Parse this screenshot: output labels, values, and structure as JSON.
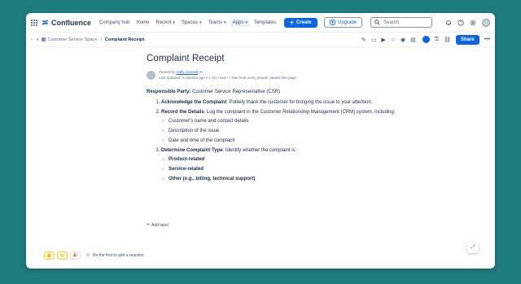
{
  "topnav": {
    "app_name": "Confluence",
    "items": [
      {
        "label": "Company hub",
        "has_chevron": false
      },
      {
        "label": "Home",
        "has_chevron": false
      },
      {
        "label": "Recent",
        "has_chevron": true
      },
      {
        "label": "Spaces",
        "has_chevron": true
      },
      {
        "label": "Teams",
        "has_chevron": true
      },
      {
        "label": "Apps",
        "has_chevron": true
      },
      {
        "label": "Templates",
        "has_chevron": false
      }
    ],
    "create_label": "Create",
    "upgrade_label": "Upgrade",
    "search_placeholder": "Search"
  },
  "breadcrumb": {
    "space": "Customer Service Space",
    "separator": "/",
    "current": "Complaint Receipt",
    "share_label": "Share"
  },
  "page": {
    "title": "Complaint Receipt",
    "owned_by_prefix": "Owned by",
    "owner": "Holly Ascinell",
    "last_updated": "Last updated: 4 minutes ago",
    "read_time": "1 min read",
    "views_text": "See how many people viewed this page",
    "responsible_label": "Responsible Party:",
    "responsible_value": " Customer Service Representative (CSR)",
    "steps": [
      {
        "title": "Acknowledge the Complaint",
        "text": ": Politely thank the customer for bringing the issue to your attention."
      },
      {
        "title": "Record the Details",
        "text": ": Log the complaint in the Customer Relationship Management (CRM) system, including:"
      },
      {
        "title": "Determine Complaint Type",
        "text": ": Identify whether the complaint is:"
      }
    ],
    "record_details": [
      "Customer's name and contact details",
      "Description of the issue",
      "Date and time of the complaint"
    ],
    "complaint_types": [
      "Product-related",
      "Service-related",
      "Other (e.g., billing, technical support)"
    ],
    "add_label": "Add label"
  },
  "reactions": {
    "prompt": "Be the first to add a reaction"
  },
  "colors": {
    "background": "#1f7d80",
    "primary": "#0c66e4"
  }
}
